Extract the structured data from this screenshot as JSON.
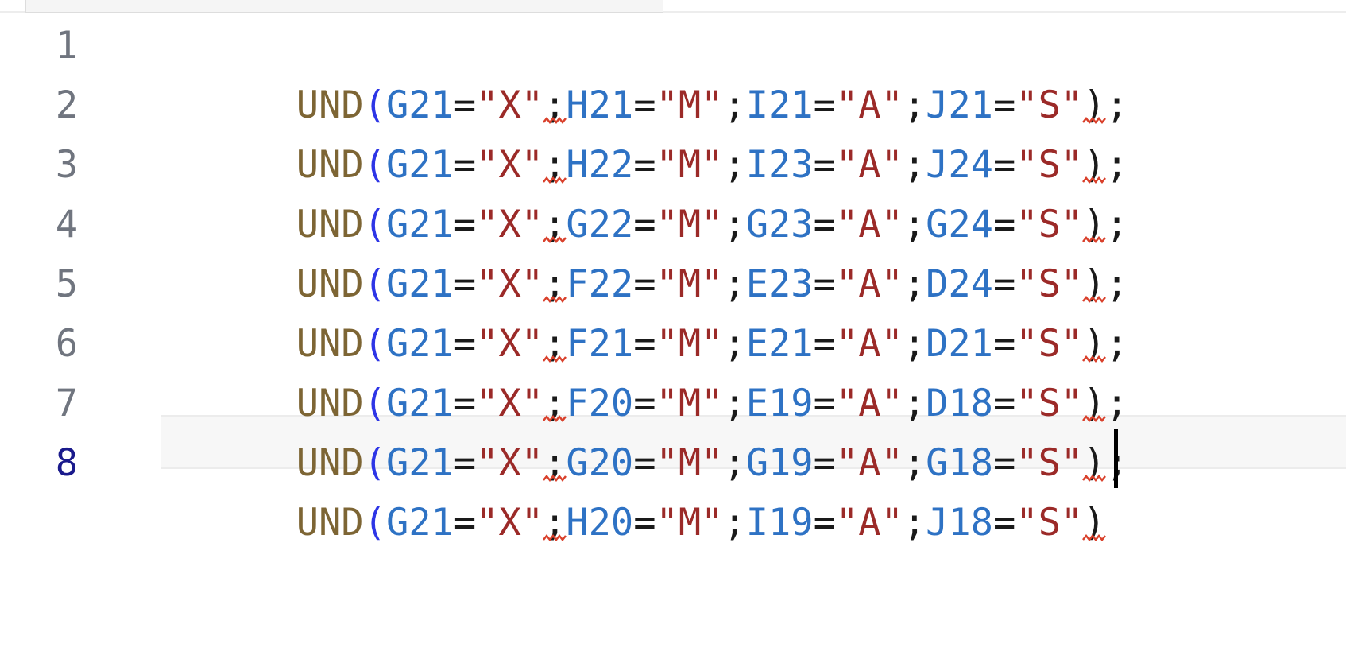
{
  "editor": {
    "active_line": 8,
    "lines": [
      {
        "number": "1",
        "fn": "UND",
        "a": "G21",
        "a_val": "\"X\"",
        "b": "H21",
        "b_val": "\"M\"",
        "c": "I21",
        "c_val": "\"A\"",
        "d": "J21",
        "d_val": "\"S\"",
        "end": ";"
      },
      {
        "number": "2",
        "fn": "UND",
        "a": "G21",
        "a_val": "\"X\"",
        "b": "H22",
        "b_val": "\"M\"",
        "c": "I23",
        "c_val": "\"A\"",
        "d": "J24",
        "d_val": "\"S\"",
        "end": ";"
      },
      {
        "number": "3",
        "fn": "UND",
        "a": "G21",
        "a_val": "\"X\"",
        "b": "G22",
        "b_val": "\"M\"",
        "c": "G23",
        "c_val": "\"A\"",
        "d": "G24",
        "d_val": "\"S\"",
        "end": ";"
      },
      {
        "number": "4",
        "fn": "UND",
        "a": "G21",
        "a_val": "\"X\"",
        "b": "F22",
        "b_val": "\"M\"",
        "c": "E23",
        "c_val": "\"A\"",
        "d": "D24",
        "d_val": "\"S\"",
        "end": ";"
      },
      {
        "number": "5",
        "fn": "UND",
        "a": "G21",
        "a_val": "\"X\"",
        "b": "F21",
        "b_val": "\"M\"",
        "c": "E21",
        "c_val": "\"A\"",
        "d": "D21",
        "d_val": "\"S\"",
        "end": ";"
      },
      {
        "number": "6",
        "fn": "UND",
        "a": "G21",
        "a_val": "\"X\"",
        "b": "F20",
        "b_val": "\"M\"",
        "c": "E19",
        "c_val": "\"A\"",
        "d": "D18",
        "d_val": "\"S\"",
        "end": ";"
      },
      {
        "number": "7",
        "fn": "UND",
        "a": "G21",
        "a_val": "\"X\"",
        "b": "G20",
        "b_val": "\"M\"",
        "c": "G19",
        "c_val": "\"A\"",
        "d": "G18",
        "d_val": "\"S\"",
        "end": ";"
      },
      {
        "number": "8",
        "fn": "UND",
        "a": "G21",
        "a_val": "\"X\"",
        "b": "H20",
        "b_val": "\"M\"",
        "c": "I19",
        "c_val": "\"A\"",
        "d": "J18",
        "d_val": "\"S\"",
        "end": ""
      }
    ]
  },
  "tokens": {
    "open_paren": "(",
    "close_paren": ")",
    "equals": "=",
    "separator": ";"
  },
  "colors": {
    "function": "#7d6534",
    "paren": "#2d35e6",
    "reference": "#2e72c4",
    "string": "#9b2a28",
    "error_squiggle": "#d9402b",
    "active_line_number": "#1a1a8c"
  },
  "icons": {
    "error_marker": "squiggle-underline-icon",
    "text_cursor": "text-cursor"
  }
}
